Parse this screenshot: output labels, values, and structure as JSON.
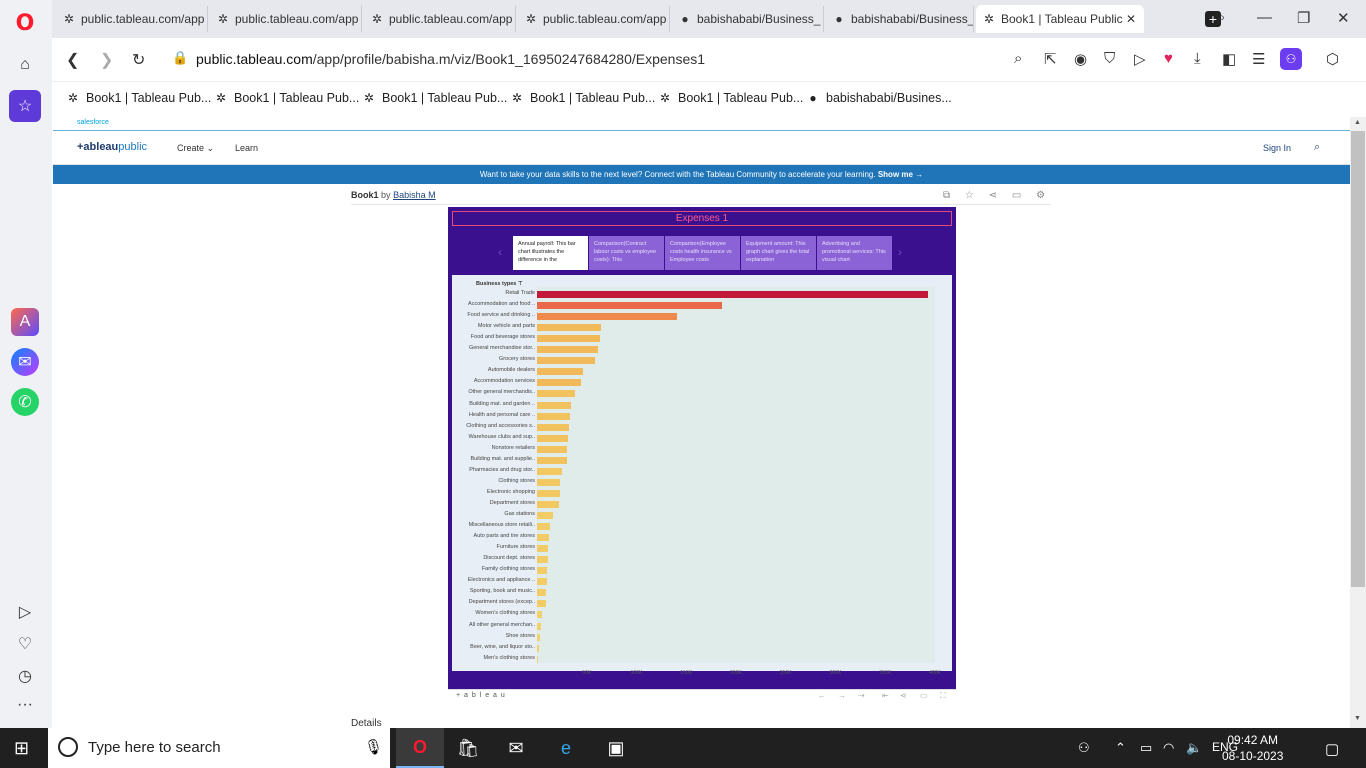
{
  "browser": {
    "tabs": [
      {
        "label": "public.tableau.com/app",
        "icon": "tableau-icon"
      },
      {
        "label": "public.tableau.com/app",
        "icon": "tableau-icon"
      },
      {
        "label": "public.tableau.com/app",
        "icon": "tableau-icon"
      },
      {
        "label": "public.tableau.com/app",
        "icon": "tableau-icon"
      },
      {
        "label": "babishababi/Business_",
        "icon": "github-icon"
      },
      {
        "label": "babishababi/Business_",
        "icon": "github-icon"
      },
      {
        "label": "Book1 | Tableau Public",
        "icon": "tableau-icon",
        "active": true
      }
    ],
    "url_domain": "public.tableau.com",
    "url_path": "/app/profile/babisha.m/viz/Book1_16950247684280/Expenses1",
    "bookmarks": [
      {
        "label": "Book1 | Tableau Pub...",
        "icon": "tableau-icon"
      },
      {
        "label": "Book1 | Tableau Pub...",
        "icon": "tableau-icon"
      },
      {
        "label": "Book1 | Tableau Pub...",
        "icon": "tableau-icon"
      },
      {
        "label": "Book1 | Tableau Pub...",
        "icon": "tableau-icon"
      },
      {
        "label": "Book1 | Tableau Pub...",
        "icon": "tableau-icon"
      },
      {
        "label": "babishababi/Busines...",
        "icon": "github-icon"
      }
    ]
  },
  "site": {
    "salesforce": "salesforce",
    "logo_main": "+ableau",
    "logo_pub": "public",
    "nav_create": "Create",
    "nav_learn": "Learn",
    "sign_in": "Sign In",
    "banner_text": "Want to take your data skills to the next level? Connect with the Tableau Community to accelerate your learning.",
    "banner_link": "Show me →",
    "viz_name": "Book1",
    "by": "by",
    "author": "Babisha M",
    "details": "Details"
  },
  "dashboard": {
    "title": "Expenses 1",
    "story_points": [
      {
        "text": "Annual payroll: This bar chart illustrates the difference in the",
        "selected": true
      },
      {
        "text": "Comparison(Contract labour costs vs employee costs): This",
        "selected": false
      },
      {
        "text": "Comparison(Employee costs health insurance vs Employee costs",
        "selected": false
      },
      {
        "text": "Equipment amount: This graph chart gives the total explanation",
        "selected": false
      },
      {
        "text": "Advertising and promotional services: This visual chart",
        "selected": false
      }
    ],
    "footer_logo": "+ a b l e a u"
  },
  "chart_data": {
    "type": "bar",
    "orientation": "horizontal",
    "legend_header": "Business types",
    "categories": [
      "Retail Trade",
      "Accommodation and food ..",
      "Food service and drinking ..",
      "Motor vehicle and parts",
      "Food and beverage stores",
      "General merchandise stor..",
      "Grocery stores",
      "Automobile dealers",
      "Accommodation services",
      "Other general merchandis..",
      "Building mat. and garden ..",
      "Health and personal care ..",
      "Clothing and accessories s..",
      "Warehouse clubs and sup..",
      "Nonstore retailers",
      "Building mat. and supplie..",
      "Pharmacies and drug stor..",
      "Clothing stores",
      "Electronic shopping",
      "Department stores",
      "Gas stations",
      "Miscellaneous store retaili..",
      "Auto parts and tire stores",
      "Furniture stores",
      "Discount dept. stores",
      "Family clothing stores",
      "Electronics and appliance ..",
      "Sporting, book and music..",
      "Department stores (excep..",
      "Women's clothing stores",
      "All other general merchan..",
      "Shoe stores",
      "Beer, wine, and liquor sto..",
      "Men's clothing stores"
    ],
    "values": [
      393000,
      186000,
      141000,
      64000,
      63000,
      61000,
      58000,
      46000,
      44000,
      38000,
      34000,
      33000,
      32000,
      31000,
      30000,
      30000,
      25000,
      23000,
      23000,
      22000,
      16000,
      13000,
      12000,
      11000,
      11000,
      10000,
      10000,
      9000,
      9000,
      5000,
      4000,
      3000,
      2000,
      1000
    ],
    "colors": [
      "#c2183a",
      "#e9684a",
      "#ef8a4a",
      "#f2b95a",
      "#f2b95a",
      "#f2b95a",
      "#f2b95a",
      "#f2b95a",
      "#f2b95a",
      "#f2c25e",
      "#f2c25e",
      "#f2c25e",
      "#f2c25e",
      "#f2c25e",
      "#f2c25e",
      "#f2c25e",
      "#f2c862",
      "#f2c862",
      "#f2c862",
      "#f2c862",
      "#f2cc66",
      "#f2cc66",
      "#f2cc66",
      "#f2cc66",
      "#f2cc66",
      "#f2cc66",
      "#f2cc66",
      "#f2cc66",
      "#f2cc66",
      "#f2d06a",
      "#f2d06a",
      "#f2d06a",
      "#f2d06a",
      "#f2d06a"
    ],
    "x_ticks": [
      "50K",
      "100K",
      "150K",
      "200K",
      "250K",
      "300K",
      "350K",
      "400K"
    ],
    "xlim": [
      0,
      400000
    ]
  },
  "taskbar": {
    "search_placeholder": "Type here to search",
    "language": "ENG",
    "time": "09:42 AM",
    "date": "08-10-2023"
  }
}
